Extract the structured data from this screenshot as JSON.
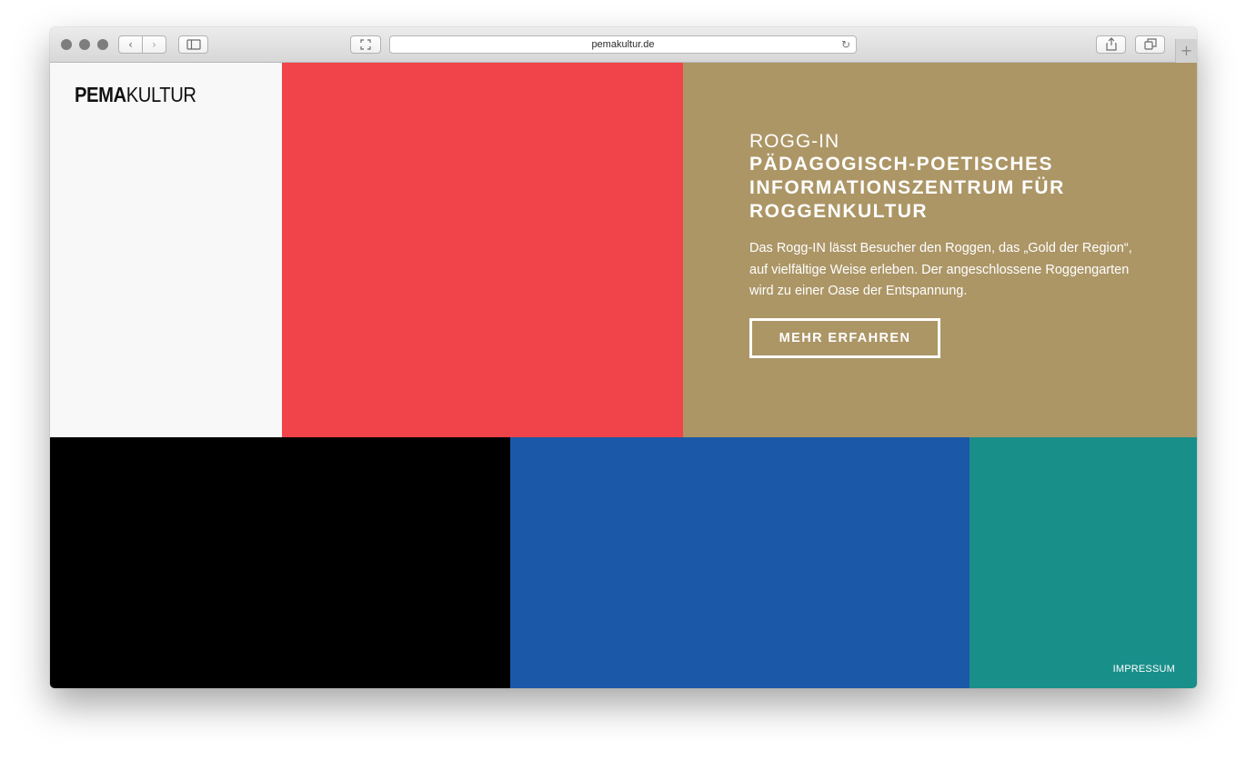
{
  "browser": {
    "url": "pemakultur.de",
    "back_glyph": "‹",
    "forward_glyph": "›",
    "reload_glyph": "↻",
    "new_tab_glyph": "+",
    "icons": [
      "back-icon",
      "forward-icon",
      "sidebar-icon",
      "fullscreen-icon",
      "reload-icon",
      "share-icon",
      "tabs-icon",
      "new-tab-icon"
    ]
  },
  "site": {
    "logo_bold": "PEMA",
    "logo_light": "KULTUR",
    "feature": {
      "eyebrow": "ROGG-IN",
      "headline_lines": [
        "PÄDAGOGISCH-POETISCHES",
        "INFORMATIONSZENTRUM FÜR",
        "ROGGENKULTUR"
      ],
      "description": "Das Rogg-IN lässt Besucher den Roggen, das „Gold der Region“, auf vielfältige Weise erleben. Der angeschlossene Roggengarten wird zu einer Oase der Entspannung.",
      "cta_label": "MEHR ERFAHREN"
    },
    "footer_link": "IMPRESSUM"
  },
  "colors": {
    "white_panel": "#f8f8f8",
    "red_panel": "#f1434a",
    "gold_panel": "#ac9666",
    "black_panel": "#000000",
    "blue_panel": "#1c58a8",
    "teal_panel": "#198f8a"
  }
}
